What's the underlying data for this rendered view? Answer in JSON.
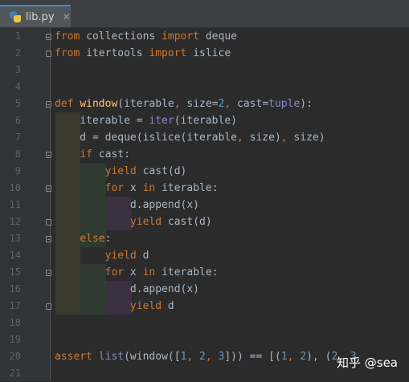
{
  "tab": {
    "filename": "lib.py",
    "close_glyph": "✕",
    "icon": "python-file-icon"
  },
  "line_numbers": [
    "1",
    "2",
    "3",
    "4",
    "5",
    "6",
    "7",
    "8",
    "9",
    "10",
    "11",
    "12",
    "13",
    "14",
    "15",
    "16",
    "17",
    "18",
    "19",
    "20",
    "21"
  ],
  "code": {
    "l1": {
      "t0": "from",
      "t1": " collections ",
      "t2": "import",
      "t3": " deque"
    },
    "l2": {
      "t0": "from",
      "t1": " itertools ",
      "t2": "import",
      "t3": " islice"
    },
    "l5": {
      "t0": "def ",
      "t1": "window",
      "t2": "(iterable",
      "t3": ", ",
      "t4": "size=",
      "t5": "2",
      "t6": ", ",
      "t7": "cast=",
      "t8": "tuple",
      "t9": "):"
    },
    "l6": {
      "t0": "    iterable = ",
      "t1": "iter",
      "t2": "(iterable)"
    },
    "l7": {
      "t0": "    d = deque(islice(iterable",
      "t1": ", ",
      "t2": "size)",
      "t3": ", ",
      "t4": "size)"
    },
    "l8": {
      "t0": "    ",
      "t1": "if",
      "t2": " cast:"
    },
    "l9": {
      "t0": "        ",
      "t1": "yield",
      "t2": " cast(d)"
    },
    "l10": {
      "t0": "        ",
      "t1": "for",
      "t2": " x ",
      "t3": "in",
      "t4": " iterable:"
    },
    "l11": {
      "t0": "            d.append(x)"
    },
    "l12": {
      "t0": "            ",
      "t1": "yield",
      "t2": " cast(d)"
    },
    "l13": {
      "t0": "    ",
      "t1": "else",
      "t2": ":"
    },
    "l14": {
      "t0": "        ",
      "t1": "yield",
      "t2": " d"
    },
    "l15": {
      "t0": "        ",
      "t1": "for",
      "t2": " x ",
      "t3": "in",
      "t4": " iterable:"
    },
    "l16": {
      "t0": "            d.append(x)"
    },
    "l17": {
      "t0": "            ",
      "t1": "yield",
      "t2": " d"
    },
    "l20": {
      "t0": "assert ",
      "t1": "list",
      "t2": "(window([",
      "t3": "1",
      "t4": ", ",
      "t5": "2",
      "t6": ", ",
      "t7": "3",
      "t8": "])) == [(",
      "t9": "1",
      "t10": ", ",
      "t11": "2",
      "t12": "), (",
      "t13": "2",
      "t14": ", ",
      "t15": "3"
    }
  },
  "watermark": "知乎 @sea",
  "colors": {
    "background": "#2b2b2b",
    "keyword": "#cc7832",
    "function_name": "#ffc66d",
    "number": "#6897bb",
    "builtin": "#8888c6",
    "default_text": "#a9b7c6"
  }
}
